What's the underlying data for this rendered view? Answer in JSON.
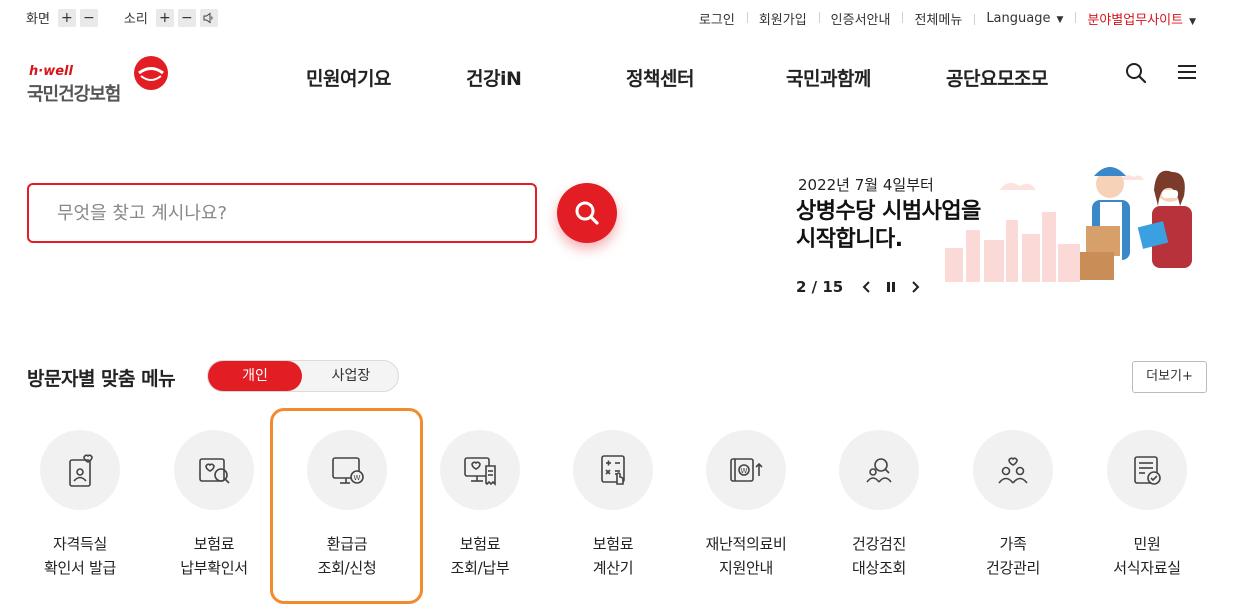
{
  "util": {
    "screen_label": "화면",
    "sound_label": "소리",
    "plus": "+",
    "minus": "−",
    "links": [
      "로그인",
      "회원가입",
      "인증서안내",
      "전체메뉴"
    ],
    "language": "Language",
    "field_sites": "분야별업무사이트"
  },
  "logo": {
    "small": "h·well",
    "big": "국민건강보험"
  },
  "gnb": [
    "민원여기요",
    "건강iN",
    "정책센터",
    "국민과함께",
    "공단요모조모"
  ],
  "search": {
    "placeholder": "무엇을 찾고 계시나요?"
  },
  "banner": {
    "date": "2022년 7월 4일부터",
    "title_line1": "상병수당 시범사업을",
    "title_line2": "시작합니다.",
    "page_current": "2",
    "page_sep": " / ",
    "page_total": "15"
  },
  "section": {
    "title": "방문자별 맞춤 메뉴",
    "tab_personal": "개인",
    "tab_business": "사업장",
    "more": "더보기+"
  },
  "menu": [
    {
      "l1": "자격득실",
      "l2": "확인서 발급"
    },
    {
      "l1": "보험료",
      "l2": "납부확인서"
    },
    {
      "l1": "환급금",
      "l2": "조회/신청"
    },
    {
      "l1": "보험료",
      "l2": "조회/납부"
    },
    {
      "l1": "보험료",
      "l2": "계산기"
    },
    {
      "l1": "재난적의료비",
      "l2": "지원안내"
    },
    {
      "l1": "건강검진",
      "l2": "대상조회"
    },
    {
      "l1": "가족",
      "l2": "건강관리"
    },
    {
      "l1": "민원",
      "l2": "서식자료실"
    }
  ],
  "colors": {
    "brand_red": "#e31d24",
    "highlight_orange": "#f28b2e"
  }
}
